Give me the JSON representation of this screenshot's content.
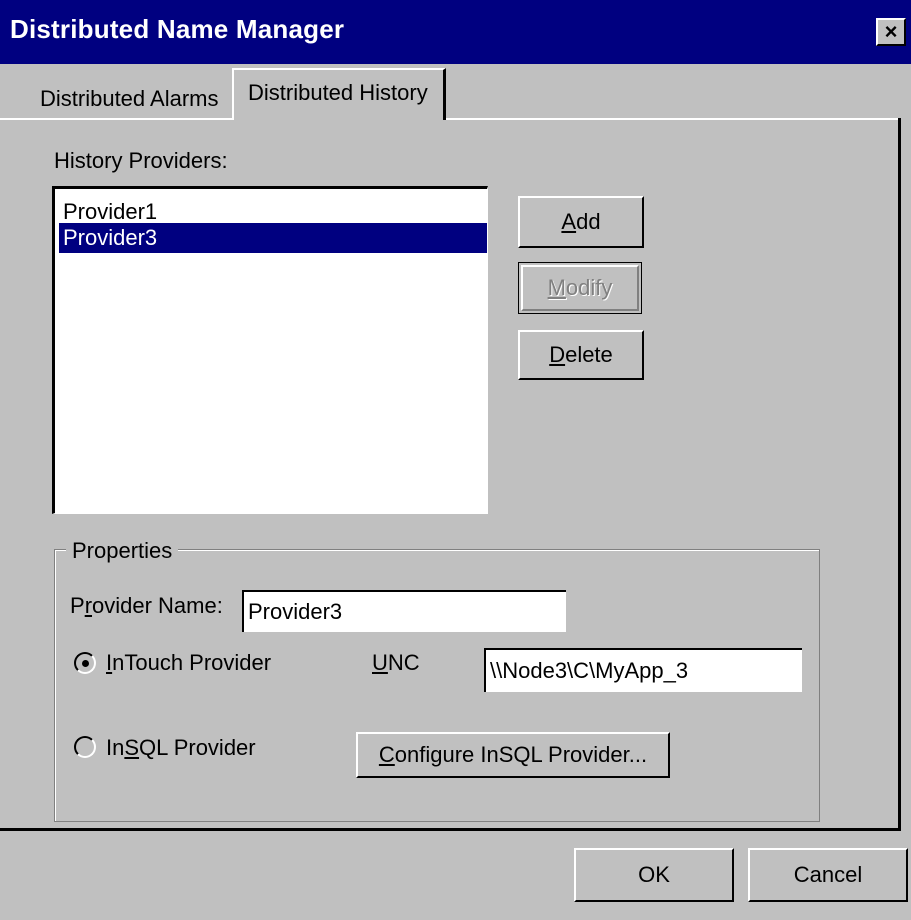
{
  "window": {
    "title": "Distributed Name Manager",
    "close_label": "×"
  },
  "tabs": [
    {
      "label": "Distributed Alarms",
      "active": false
    },
    {
      "label": "Distributed History",
      "active": true
    }
  ],
  "providers": {
    "label": "History Providers:",
    "items": [
      {
        "name": "Provider1",
        "selected": false
      },
      {
        "name": "Provider3",
        "selected": true
      }
    ]
  },
  "buttons": {
    "add": {
      "access": "A",
      "rest": "dd"
    },
    "modify": {
      "access": "M",
      "rest": "odify",
      "enabled": false
    },
    "delete": {
      "access": "D",
      "rest": "elete"
    }
  },
  "properties": {
    "group_label": "Properties",
    "provider_name_label": {
      "pre": "P",
      "access": "r",
      "rest": "ovider Name:"
    },
    "provider_name_value": "Provider3",
    "intouch_radio": {
      "pre": "",
      "access": "I",
      "rest": "nTouch Provider",
      "checked": true
    },
    "unc_label": {
      "access": "U",
      "rest": "NC"
    },
    "unc_value": "\\\\Node3\\C\\MyApp_3",
    "insql_radio": {
      "pre": "In",
      "access": "S",
      "rest": "QL Provider",
      "checked": false
    },
    "configure_button": {
      "access": "C",
      "rest": "onfigure InSQL Provider..."
    }
  },
  "footer": {
    "ok_label": "OK",
    "cancel_label": "Cancel"
  },
  "colors": {
    "face": "#c0c0c0",
    "title_bar": "#000080",
    "selection": "#000080"
  }
}
